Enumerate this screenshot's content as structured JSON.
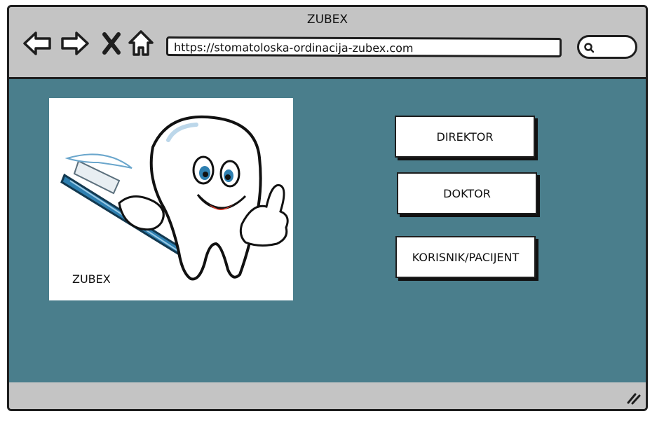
{
  "window": {
    "title": "ZUBEX"
  },
  "toolbar": {
    "icons": [
      "back-arrow-icon",
      "forward-arrow-icon",
      "close-x-icon",
      "home-icon"
    ],
    "url": "https://stomatoloska-ordinacija-zubex.com",
    "search_icon": "search-icon"
  },
  "main": {
    "logo": {
      "caption": "ZUBEX",
      "image": "tooth-with-toothbrush-illustration"
    },
    "roles": [
      {
        "label": "DIREKTOR"
      },
      {
        "label": "DOKTOR"
      },
      {
        "label": "KORISNIK/PACIJENT"
      }
    ]
  },
  "colors": {
    "content_background": "#4a7e8c",
    "chrome": "#c4c4c4",
    "outline": "#1e1e1e",
    "tooth_blue": "#2e7fb0",
    "tongue_red": "#e03a2a"
  }
}
